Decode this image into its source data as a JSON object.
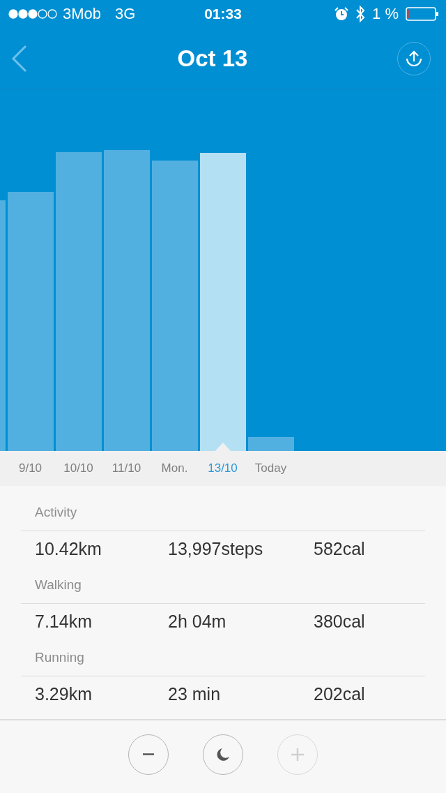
{
  "status_bar": {
    "carrier": "3Mob",
    "network": "3G",
    "time": "01:33",
    "battery_percent": "1 %"
  },
  "nav": {
    "title": "Oct 13"
  },
  "dates": [
    {
      "label": "9/10",
      "selected": false
    },
    {
      "label": "10/10",
      "selected": false
    },
    {
      "label": "11/10",
      "selected": false
    },
    {
      "label": "Mon.",
      "selected": false
    },
    {
      "label": "13/10",
      "selected": true
    },
    {
      "label": "Today",
      "selected": false
    }
  ],
  "sections": [
    {
      "title": "Activity",
      "values": [
        "10.42km",
        "13,997steps",
        "582cal"
      ]
    },
    {
      "title": "Walking",
      "values": [
        "7.14km",
        "2h 04m",
        "380cal"
      ]
    },
    {
      "title": "Running",
      "values": [
        "3.29km",
        "23 min",
        "202cal"
      ]
    }
  ],
  "toolbar": [
    {
      "kind": "minus",
      "disabled": false
    },
    {
      "kind": "sleep",
      "disabled": false
    },
    {
      "kind": "plus",
      "disabled": true
    }
  ]
}
